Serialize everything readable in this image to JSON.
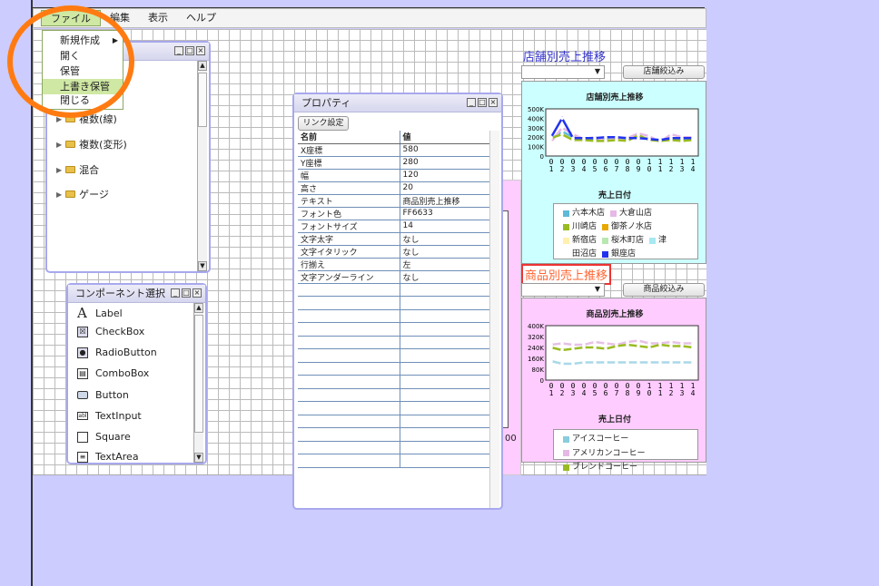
{
  "menubar": {
    "file": "ファイル",
    "edit": "編集",
    "view": "表示",
    "help": "ヘルプ"
  },
  "file_menu": {
    "new": "新規作成",
    "open": "開く",
    "save": "保管",
    "overwrite": "上書き保管",
    "close": "閉じる"
  },
  "tree": {
    "items": [
      "複数(線)",
      "複数(変形)",
      "混合",
      "ゲージ"
    ]
  },
  "components": {
    "title": "コンポーネント選択",
    "items": [
      "Label",
      "CheckBox",
      "RadioButton",
      "ComboBox",
      "Button",
      "TextInput",
      "Square",
      "TextArea"
    ]
  },
  "properties": {
    "title": "プロパティ",
    "link_button": "リンク設定",
    "header_name": "名前",
    "header_value": "値",
    "rows": [
      {
        "name": "X座標",
        "value": "580"
      },
      {
        "name": "Y座標",
        "value": "280"
      },
      {
        "name": "幅",
        "value": "120"
      },
      {
        "name": "高さ",
        "value": "20"
      },
      {
        "name": "テキスト",
        "value": "商品別売上推移"
      },
      {
        "name": "フォント色",
        "value": "FF6633"
      },
      {
        "name": "フォントサイズ",
        "value": "14"
      },
      {
        "name": "文字太字",
        "value": "なし"
      },
      {
        "name": "文字イタリック",
        "value": "なし"
      },
      {
        "name": "行揃え",
        "value": "左"
      },
      {
        "name": "文字アンダーライン",
        "value": "なし"
      }
    ]
  },
  "canvas_fragment": "00",
  "store_section": {
    "heading": "店舗別売上推移",
    "filter_button": "店舗絞込み",
    "chart": {
      "title": "店舗別売上推移",
      "xlabel": "売上日付",
      "y_ticks": [
        "500K",
        "400K",
        "300K",
        "200K",
        "100K",
        "0"
      ],
      "x_ticks": [
        "0\n1",
        "0\n2",
        "0\n3",
        "0\n4",
        "0\n5",
        "0\n6",
        "0\n7",
        "0\n8",
        "0\n9",
        "1\n0",
        "1\n1",
        "1\n2",
        "1\n3",
        "1\n4"
      ],
      "legend": [
        {
          "label": "六本木店",
          "color": "#5fb9d8"
        },
        {
          "label": "大倉山店",
          "color": "#e6b8e6"
        },
        {
          "label": "川崎店",
          "color": "#99bb22"
        },
        {
          "label": "御茶ノ水店",
          "color": "#e8a800"
        },
        {
          "label": "新宿店",
          "color": "#fff0b0"
        },
        {
          "label": "桜木町店",
          "color": "#b8e8b0"
        },
        {
          "label": "津",
          "color": "#a8e8f0"
        },
        {
          "label": "田沼店",
          "color": "#ffffff"
        },
        {
          "label": "銀座店",
          "color": "#2233ee"
        }
      ]
    }
  },
  "product_section": {
    "heading": "商品別売上推移",
    "filter_button": "商品絞込み",
    "chart": {
      "title": "商品別売上推移",
      "xlabel": "売上日付",
      "y_ticks": [
        "400K",
        "320K",
        "240K",
        "160K",
        "80K",
        "0"
      ],
      "x_ticks": [
        "0\n1",
        "0\n2",
        "0\n3",
        "0\n4",
        "0\n5",
        "0\n6",
        "0\n7",
        "0\n8",
        "0\n9",
        "1\n0",
        "1\n1",
        "1\n2",
        "1\n3",
        "1\n4"
      ],
      "legend": [
        {
          "label": "アイスコーヒー",
          "color": "#88ccdd"
        },
        {
          "label": "アメリカンコーヒー",
          "color": "#e6b8e6"
        },
        {
          "label": "ブレンドコーヒー",
          "color": "#99bb22"
        }
      ]
    }
  },
  "chart_data": [
    {
      "type": "line",
      "title": "店舗別売上推移",
      "xlabel": "売上日付",
      "categories": [
        "01",
        "02",
        "03",
        "04",
        "05",
        "06",
        "07",
        "08",
        "09",
        "10",
        "11",
        "12",
        "13",
        "14"
      ],
      "ylim": [
        0,
        500000
      ],
      "series": [
        {
          "name": "六本木店",
          "values": [
            180000,
            260000,
            200000,
            180000,
            180000,
            170000,
            190000,
            180000,
            200000,
            180000,
            170000,
            190000,
            180000,
            170000
          ]
        },
        {
          "name": "大倉山店",
          "values": [
            150000,
            300000,
            230000,
            180000,
            200000,
            160000,
            190000,
            190000,
            240000,
            210000,
            150000,
            230000,
            200000,
            200000
          ]
        },
        {
          "name": "川崎店",
          "values": [
            190000,
            230000,
            170000,
            170000,
            160000,
            160000,
            170000,
            160000,
            220000,
            170000,
            160000,
            170000,
            160000,
            170000
          ]
        },
        {
          "name": "銀座店",
          "values": [
            200000,
            400000,
            190000,
            190000,
            190000,
            200000,
            200000,
            190000,
            190000,
            180000,
            170000,
            190000,
            190000,
            190000
          ]
        }
      ]
    },
    {
      "type": "line",
      "title": "商品別売上推移",
      "xlabel": "売上日付",
      "categories": [
        "01",
        "02",
        "03",
        "04",
        "05",
        "06",
        "07",
        "08",
        "09",
        "10",
        "11",
        "12",
        "13",
        "14"
      ],
      "ylim": [
        0,
        400000
      ],
      "series": [
        {
          "name": "アイスコーヒー",
          "values": [
            140000,
            120000,
            120000,
            130000,
            130000,
            130000,
            130000,
            130000,
            130000,
            130000,
            130000,
            130000,
            130000,
            130000
          ]
        },
        {
          "name": "アメリカンコーヒー",
          "values": [
            260000,
            270000,
            260000,
            260000,
            280000,
            270000,
            260000,
            280000,
            290000,
            270000,
            270000,
            280000,
            270000,
            270000
          ]
        },
        {
          "name": "ブレンドコーヒー",
          "values": [
            240000,
            220000,
            230000,
            240000,
            240000,
            230000,
            250000,
            260000,
            250000,
            240000,
            260000,
            250000,
            250000,
            240000
          ]
        }
      ]
    }
  ]
}
